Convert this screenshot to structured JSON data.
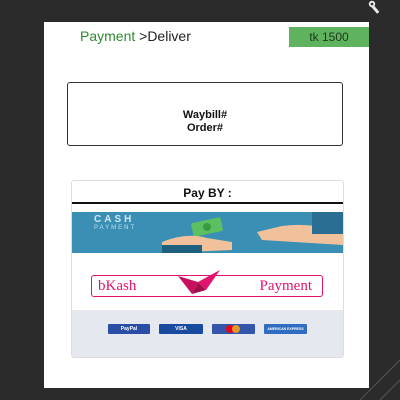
{
  "header": {
    "title_green": "Payment",
    "title_rest": " >Deliver",
    "amount": "tk 1500"
  },
  "waybill": {
    "line1": "Waybill#",
    "line2": "Order#"
  },
  "payment": {
    "title": "Pay BY :",
    "cash": {
      "text": "CASH",
      "sub": "PAYMENT"
    },
    "bkash": {
      "brand": "bKash",
      "payment": "Payment"
    },
    "cards": [
      {
        "name": "PayPal",
        "color": "#2a4ea6"
      },
      {
        "name": "VISA",
        "color": "#1a4aa0"
      },
      {
        "name": "mastercard",
        "color": "#3355aa"
      },
      {
        "name": "AMERICAN EXPRESS",
        "color": "#2f6dc3"
      }
    ]
  },
  "colors": {
    "background": "#2b2b2b",
    "accent_green": "#2e8b2e",
    "badge_green": "#5fb35f",
    "bkash_pink": "#e2136e",
    "cash_blue": "#3b8fb5"
  }
}
